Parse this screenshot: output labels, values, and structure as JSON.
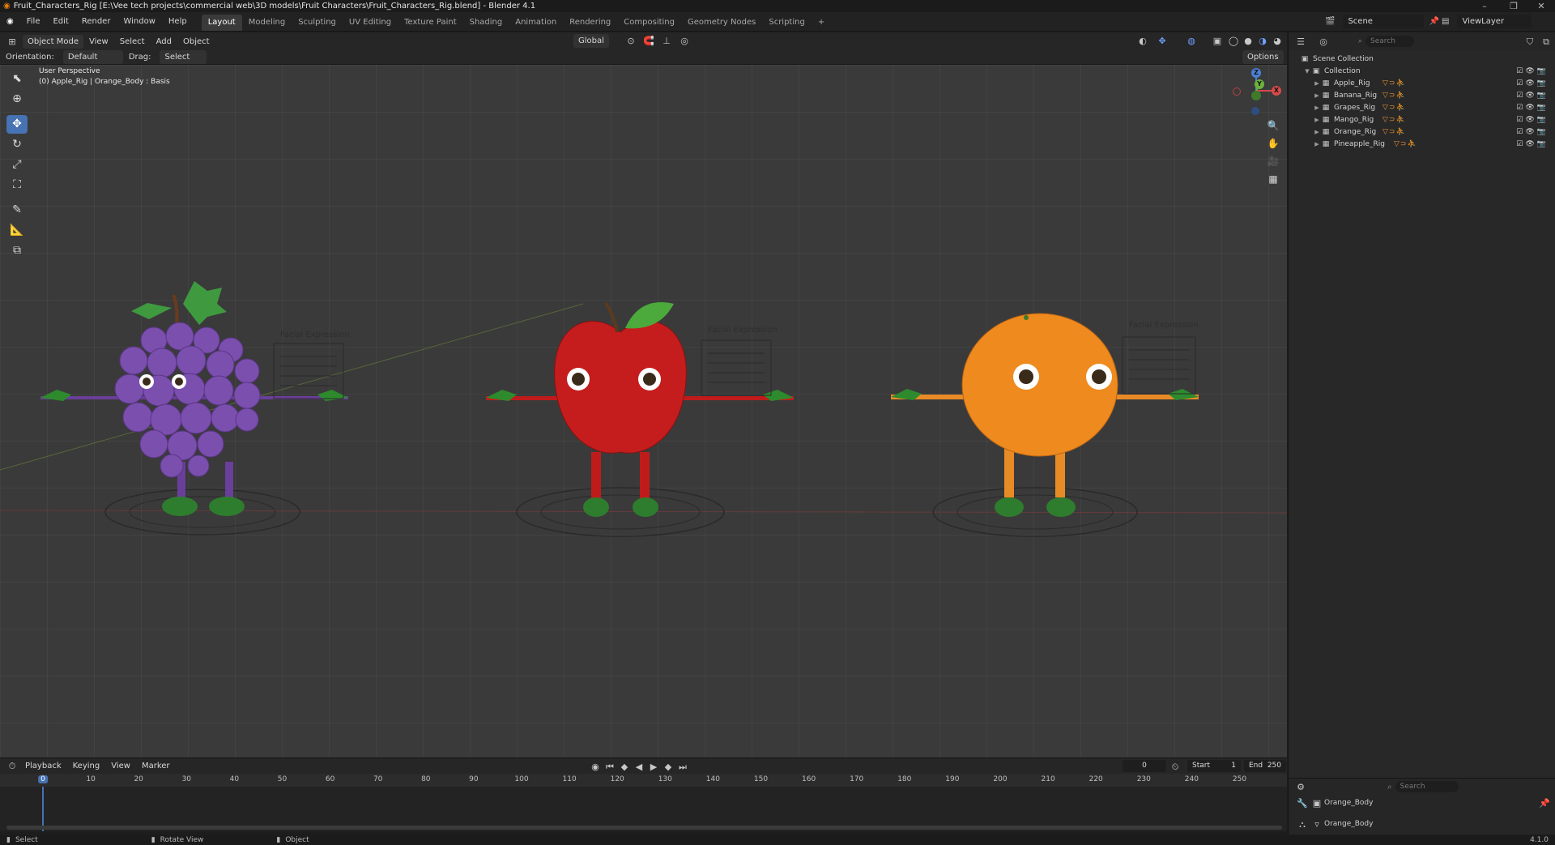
{
  "window": {
    "title": "Fruit_Characters_Rig [E:\\Vee tech projects\\commercial web\\3D models\\Fruit Characters\\Fruit_Characters_Rig.blend] - Blender 4.1",
    "minimize": "–",
    "maximize": "❐",
    "close": "✕"
  },
  "menu": [
    "File",
    "Edit",
    "Render",
    "Window",
    "Help"
  ],
  "workspaces": [
    {
      "label": "Layout",
      "active": true
    },
    {
      "label": "Modeling"
    },
    {
      "label": "Sculpting"
    },
    {
      "label": "UV Editing"
    },
    {
      "label": "Texture Paint"
    },
    {
      "label": "Shading"
    },
    {
      "label": "Animation"
    },
    {
      "label": "Rendering"
    },
    {
      "label": "Compositing"
    },
    {
      "label": "Geometry Nodes"
    },
    {
      "label": "Scripting"
    }
  ],
  "add_workspace": "+",
  "scene": {
    "label": "Scene",
    "view_layer": "ViewLayer"
  },
  "viewport_header": {
    "mode": "Object Mode",
    "menus": [
      "View",
      "Select",
      "Add",
      "Object"
    ],
    "transform_orientation": "Global",
    "orientation_label": "Orientation:",
    "orientation_value": "Default",
    "drag_label": "Drag:",
    "drag_value": "Select Cir...",
    "options": "Options"
  },
  "viewport": {
    "perspective": "User Perspective",
    "object_info": "(0) Apple_Rig | Orange_Body : Basis",
    "gizmo": {
      "z": "Z",
      "y": "Y",
      "x": "X"
    },
    "characters": [
      {
        "name": "grapes",
        "label": "Facial Expression",
        "body_color": "#7b4fae",
        "limb_color": "#6a3f9a"
      },
      {
        "name": "apple",
        "label": "Facial Expression",
        "body_color": "#c51d1d",
        "limb_color": "#c01b1b"
      },
      {
        "name": "orange",
        "label": "Facial Expression",
        "body_color": "#ef8a1f",
        "limb_color": "#e88a26"
      }
    ]
  },
  "outliner": {
    "search_placeholder": "Search",
    "root": "Scene Collection",
    "collection": "Collection",
    "items": [
      {
        "label": "Apple_Rig"
      },
      {
        "label": "Banana_Rig"
      },
      {
        "label": "Grapes_Rig"
      },
      {
        "label": "Mango_Rig"
      },
      {
        "label": "Orange_Rig"
      },
      {
        "label": "Pineapple_Rig"
      }
    ],
    "mod_glyphs": "▽⊃⛹",
    "toggles": "☑👁📷"
  },
  "timeline": {
    "menus": [
      "Playback",
      "Keying",
      "View",
      "Marker"
    ],
    "current_frame": "0",
    "start_label": "Start",
    "start_value": "1",
    "end_label": "End",
    "end_value": "250",
    "ticks": [
      "0",
      "10",
      "20",
      "30",
      "40",
      "50",
      "60",
      "70",
      "80",
      "90",
      "100",
      "110",
      "120",
      "130",
      "140",
      "150",
      "160",
      "170",
      "180",
      "190",
      "200",
      "210",
      "220",
      "230",
      "240",
      "250"
    ]
  },
  "properties": {
    "search_placeholder": "Search",
    "object": "Orange_Body",
    "data": "Orange_Body"
  },
  "statusbar": {
    "select": "Select",
    "rotate": "Rotate View",
    "object": "Object",
    "version": "4.1.0"
  },
  "colors": {
    "accent": "#4772b3",
    "viewport_bg": "#3a3a3a",
    "modifier_orange": "#e58f3a"
  }
}
